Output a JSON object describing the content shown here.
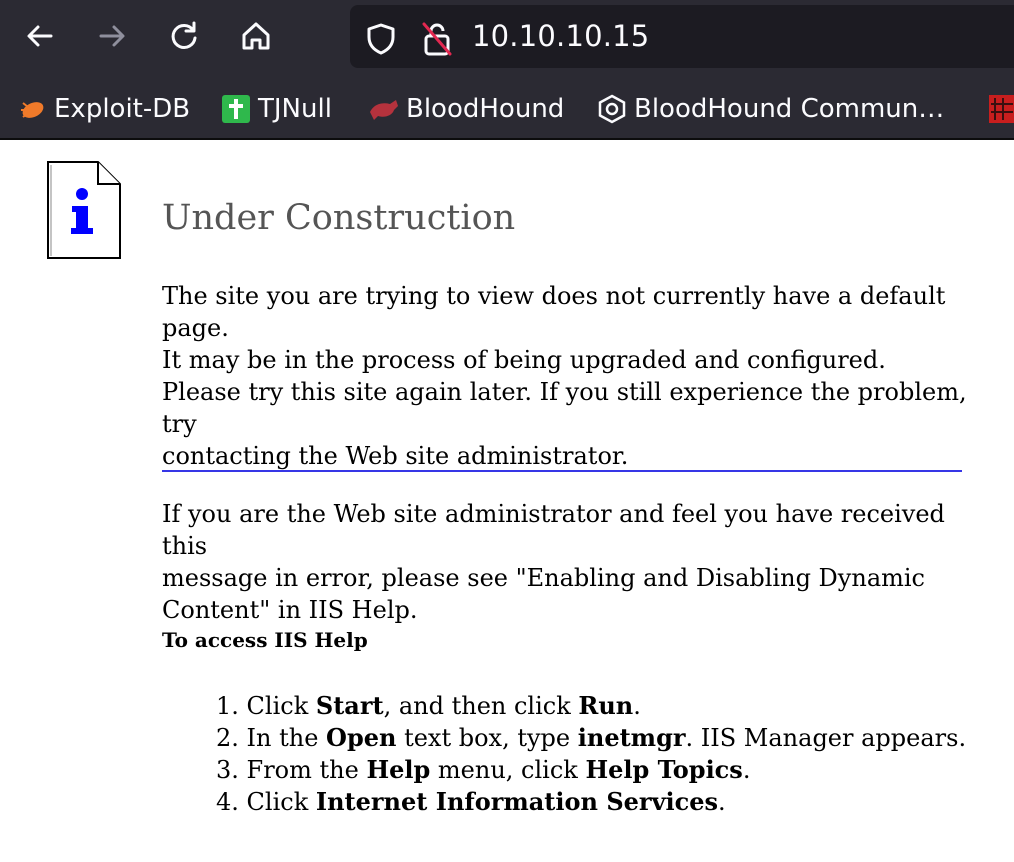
{
  "browser": {
    "url": "10.10.10.15",
    "bookmarks": [
      {
        "label": "Exploit-DB",
        "icon": "exploitdb-bug-icon"
      },
      {
        "label": "TJNull",
        "icon": "tjnull-cross-icon"
      },
      {
        "label": "BloodHound",
        "icon": "bloodhound-dog-icon"
      },
      {
        "label": "BloodHound Commun…",
        "icon": "bloodhound-community-hex-icon"
      }
    ],
    "colors": {
      "toolbar": "#2b2a33",
      "urlbar": "#1c1b22",
      "text": "#fbfbfe"
    }
  },
  "page": {
    "title": "Under Construction",
    "paragraph1_line1": "The site you are trying to view does not currently have a default page.",
    "paragraph1_line2": "It may be in the process of being upgraded and configured.",
    "paragraph2_line1": "Please try this site again later. If you still experience the problem, try",
    "paragraph2_line2": "contacting the Web site administrator.",
    "paragraph3_line1": "If you are the Web site administrator and feel you have received this",
    "paragraph3_line2": "message in error, please see \"Enabling and Disabling Dynamic",
    "paragraph3_line3": "Content\" in IIS Help.",
    "help_heading": "To access IIS Help",
    "steps": [
      {
        "n": "1.",
        "parts": [
          "Click ",
          "Start",
          ", and then click ",
          "Run",
          "."
        ]
      },
      {
        "n": "2.",
        "parts": [
          "In the ",
          "Open",
          " text box, type ",
          "inetmgr",
          ". IIS Manager appears."
        ]
      },
      {
        "n": "3.",
        "parts": [
          "From the ",
          "Help",
          " menu, click ",
          "Help Topics",
          "."
        ]
      },
      {
        "n": "4.",
        "parts": [
          "Click ",
          "Internet Information Services",
          "."
        ]
      }
    ],
    "colors": {
      "title": "#555555",
      "divider": "#3636e6",
      "info_icon": "#0000ff"
    }
  }
}
